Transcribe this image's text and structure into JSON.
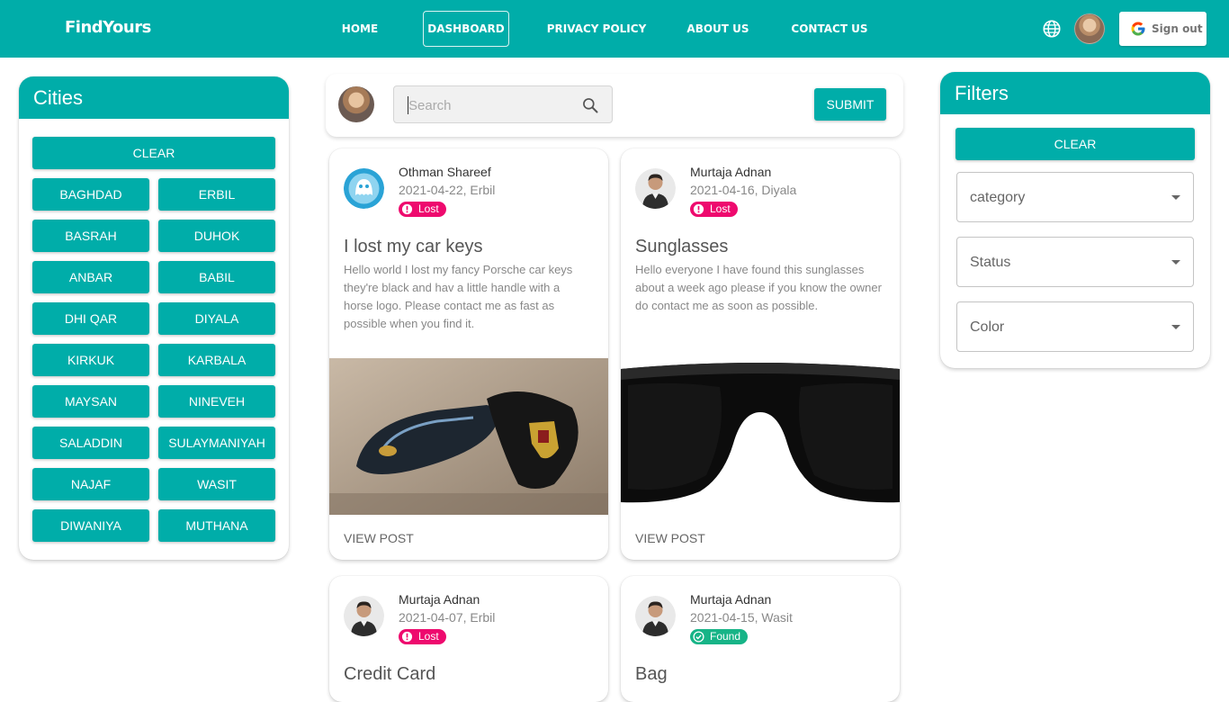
{
  "nav": {
    "brand": "FindYours",
    "links": [
      "HOME",
      "DASHBOARD",
      "PRIVACY POLICY",
      "ABOUT US",
      "CONTACT US"
    ],
    "active": "DASHBOARD",
    "signout_label": "Sign out",
    "icons": [
      "globe-icon",
      "google-icon"
    ]
  },
  "cities": {
    "title": "Cities",
    "clear_label": "CLEAR",
    "items": [
      "BAGHDAD",
      "ERBIL",
      "BASRAH",
      "DUHOK",
      "ANBAR",
      "BABIL",
      "DHI QAR",
      "DIYALA",
      "KIRKUK",
      "KARBALA",
      "MAYSAN",
      "NINEVEH",
      "SALADDIN",
      "SULAYMANIYAH",
      "NAJAF",
      "WASIT",
      "DIWANIYA",
      "MUTHANA"
    ]
  },
  "search": {
    "placeholder": "Search",
    "submit_label": "SUBMIT"
  },
  "filters": {
    "title": "Filters",
    "clear_label": "CLEAR",
    "selects": [
      "category",
      "Status",
      "Color"
    ]
  },
  "posts": [
    {
      "author": "Othman Shareef",
      "meta": "2021-04-22, Erbil",
      "status": "Lost",
      "title": "I lost my car keys",
      "body": "Hello world I lost my fancy Porsche car keys they're black and hav a little handle with a horse logo. Please contact me as fast as possible when you find it.",
      "action": "VIEW POST"
    },
    {
      "author": "Murtaja Adnan",
      "meta": "2021-04-16, Diyala",
      "status": "Lost",
      "title": "Sunglasses",
      "body": "Hello everyone I have found this sunglasses about a week ago please if you know the owner do contact me as soon as possible.",
      "action": "VIEW POST"
    },
    {
      "author": "Murtaja Adnan",
      "meta": "2021-04-07, Erbil",
      "status": "Lost",
      "title": "Credit Card"
    },
    {
      "author": "Murtaja Adnan",
      "meta": "2021-04-15, Wasit",
      "status": "Found",
      "title": "Bag"
    }
  ],
  "colors": {
    "primary": "#00ada9",
    "lost": "#ee0a6e",
    "found": "#17b487"
  }
}
